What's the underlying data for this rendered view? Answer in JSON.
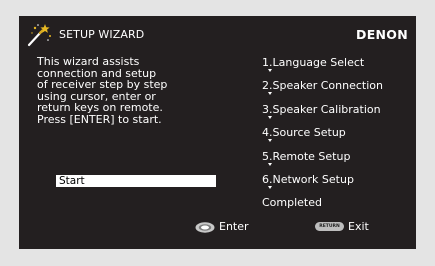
{
  "header": {
    "title": "SETUP WIZARD",
    "brand": "DENON",
    "icon": "magic-wand-icon"
  },
  "description_lines": [
    "This wizard assists",
    "connection and setup",
    "of receiver step by step",
    "using cursor, enter or",
    "return keys on remote.",
    "Press [ENTER] to start."
  ],
  "start_button": {
    "label": "Start"
  },
  "steps": [
    "1.Language Select",
    "2.Speaker Connection",
    "3.Speaker Calibration",
    "4.Source Setup",
    "5.Remote Setup",
    "6.Network Setup",
    "Completed"
  ],
  "footer": {
    "enter_icon": "remote-enter-button-icon",
    "enter_label": "Enter",
    "return_icon_text": "RETURN",
    "exit_label": "Exit"
  },
  "colors": {
    "screen_background": "#231f20",
    "frame_background": "#e4e4e4",
    "text": "#ffffff",
    "selection_highlight": "#ffffff"
  }
}
